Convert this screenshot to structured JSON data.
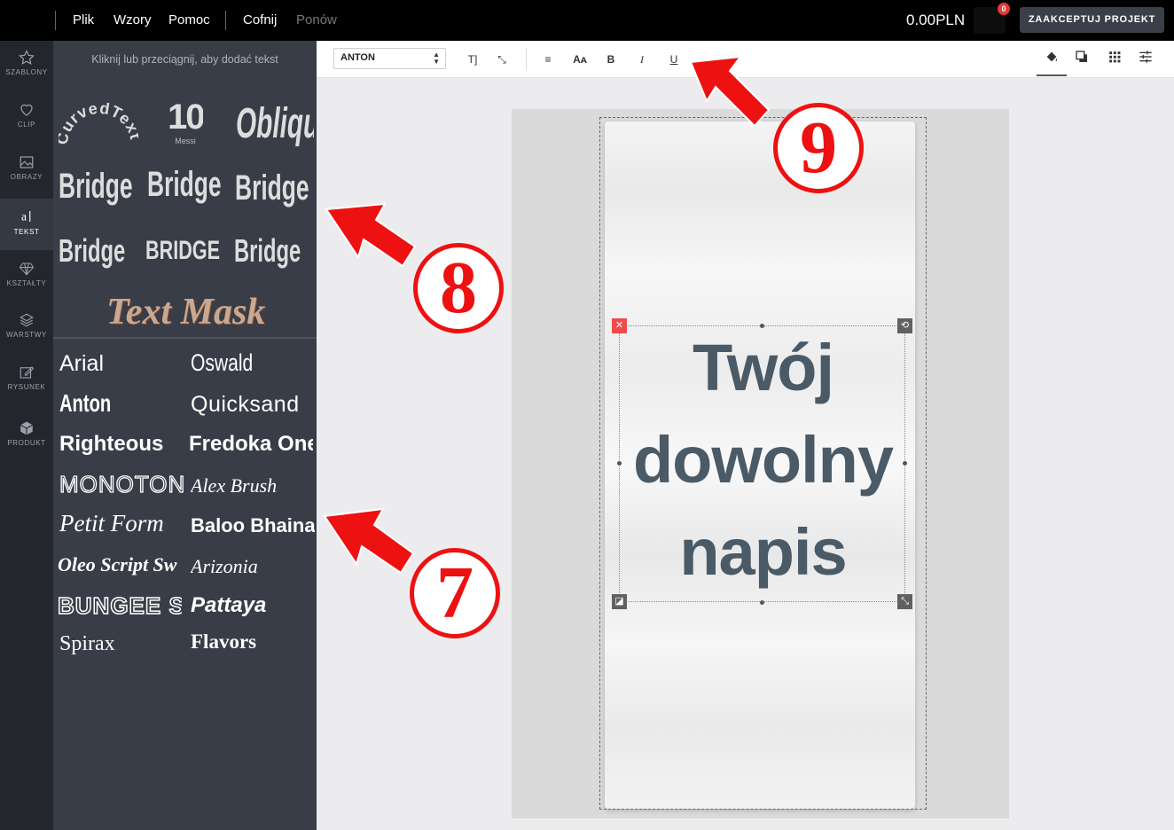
{
  "topbar": {
    "menu": [
      {
        "label": "Plik"
      },
      {
        "label": "Wzory"
      },
      {
        "label": "Pomoc"
      },
      {
        "label": "Cofnij"
      },
      {
        "label": "Ponów"
      }
    ],
    "price": "0.00PLN",
    "cart_count": "0",
    "accept_label": "ZAAKCEPTUJ PROJEKT"
  },
  "rail": [
    {
      "label": "SZABLONY",
      "icon": "star-icon"
    },
    {
      "label": "CLIP",
      "icon": "heart-icon"
    },
    {
      "label": "OBRAZY",
      "icon": "image-icon"
    },
    {
      "label": "TEKST",
      "icon": "text-icon"
    },
    {
      "label": "KSZTAŁTY",
      "icon": "diamond-icon"
    },
    {
      "label": "WARSTWY",
      "icon": "layers-icon"
    },
    {
      "label": "RYSUNEK",
      "icon": "draw-icon"
    },
    {
      "label": "PRODUKT",
      "icon": "box-icon"
    }
  ],
  "panel": {
    "hint": "Kliknij lub przeciągnij, aby dodać tekst",
    "presets": {
      "curved": "CurvedText",
      "number": "10",
      "number_sub": "Messi",
      "oblique": "Oblique",
      "bridge": "Bridge",
      "bridge_caps": "BRIDGE",
      "mask": "Text Mask"
    },
    "fonts": [
      "Arial",
      "Oswald",
      "Anton",
      "Quicksand",
      "Righteous",
      "Fredoka One",
      "MONOTON",
      "Alex Brush",
      "Petit Form",
      "Baloo Bhaina",
      "Oleo Script Sw",
      "Arizonia",
      "BUNGEE S",
      "Pattaya",
      "Spirax",
      "Flavors"
    ]
  },
  "toolbar": {
    "font_value": "ANTON",
    "tools": [
      "T]",
      "⤡",
      "≡",
      "Aᴀ",
      "B",
      "I",
      "U"
    ],
    "right_tools": [
      "fill-icon",
      "shadow-icon",
      "grid-icon",
      "sliders-icon"
    ]
  },
  "design": {
    "lines": [
      "Twój",
      "dowolny",
      "napis"
    ],
    "text_color": "#4a5a66"
  },
  "annotations": [
    "9",
    "8",
    "7"
  ],
  "colors": {
    "accent_red": "#ee1111",
    "panel_bg": "#393d47",
    "rail_bg": "#23262c"
  }
}
